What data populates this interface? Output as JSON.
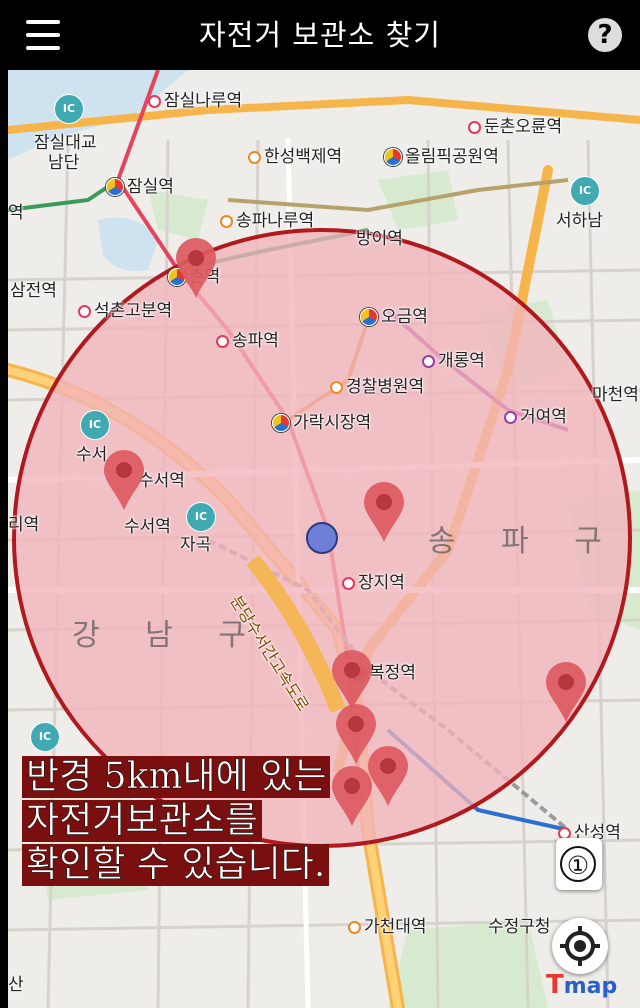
{
  "header": {
    "title": "자전거 보관소 찾기",
    "help_label": "?"
  },
  "map": {
    "station_labels": {
      "jamsil_naru": "잠실나루역",
      "jamsil_bridge": "잠실대교",
      "jamsil_bridge_south": "남단",
      "jamsil": "잠실역",
      "hanseong_baekje": "한성백제역",
      "olympic_park": "올림픽공원역",
      "dunchon_oryun": "둔촌오륜역",
      "songpa_naru": "송파나루역",
      "bangi": "방이역",
      "seohanam": "서하남",
      "samjeon": "삼전역",
      "seokchon_gobun": "석촌고분역",
      "seokchon": "촌역",
      "ogeum": "오금역",
      "songpa": "송파역",
      "gaerong": "개롱역",
      "police_hospital": "경찰병원역",
      "garak_market": "가락시장역",
      "geoyeo": "거여역",
      "macheon": "마천역",
      "suseo_ic": "수서",
      "suseo_station": "수서역",
      "suseo": "수서역",
      "jigok": "자곡",
      "jangji": "장지역",
      "bokjeong": "복정역",
      "left_edge_station": "역",
      "left_edge_station2": "리역",
      "sanseong": "산성역",
      "gacheon": "가천대역",
      "sujeong": "수정구청",
      "bottom_left": "산"
    },
    "district_songpa": "송 파 구",
    "district_gangnam": "강 남 구",
    "expressway": "분당수서간고속도로",
    "ic_label": "IC"
  },
  "overlay": {
    "info_lines": [
      "반경 5km내에 있는",
      "자전거보관소를",
      "확인할 수 있습니다."
    ]
  },
  "controls": {
    "count_label": "①",
    "brand_t": "T",
    "brand_map": "map"
  },
  "colors": {
    "radius_fill": "#f2b3bb",
    "radius_stroke": "#b01a1f",
    "pin": "#dc5a60",
    "current_location": "#6f7fd8",
    "info_bg": "#7a0f0f"
  }
}
